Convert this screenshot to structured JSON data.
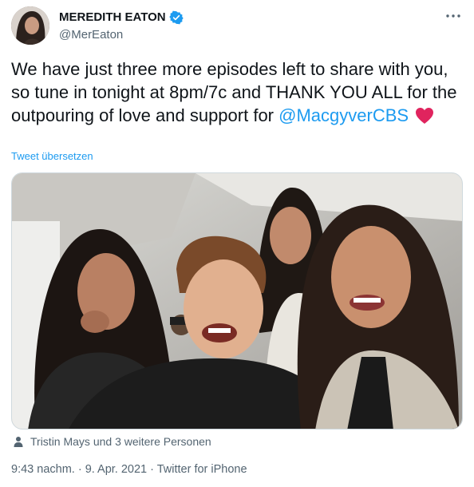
{
  "author": {
    "display_name": "MEREDITH EATON",
    "handle": "@MerEaton",
    "verified": true
  },
  "tweet": {
    "text": "We have just three more episodes left to share with you, so tune in tonight at 8pm/7c and THANK YOU ALL for the outpouring of love and support for ",
    "mention": "@MacgyverCBS",
    "translate_link": "Tweet übersetzen"
  },
  "media": {
    "tagged_text": "Tristin Mays und 3 weitere Personen"
  },
  "meta": {
    "time": "9:43 nachm.",
    "separator": " · ",
    "date": "9. Apr. 2021",
    "source": "Twitter for iPhone"
  },
  "colors": {
    "link": "#1d9bf0",
    "secondary_text": "#536471",
    "heart": "#e0245e"
  },
  "icons": {
    "verified": "verified-badge-icon",
    "more": "more-options-icon",
    "heart": "red-heart-emoji",
    "person": "person-icon"
  }
}
